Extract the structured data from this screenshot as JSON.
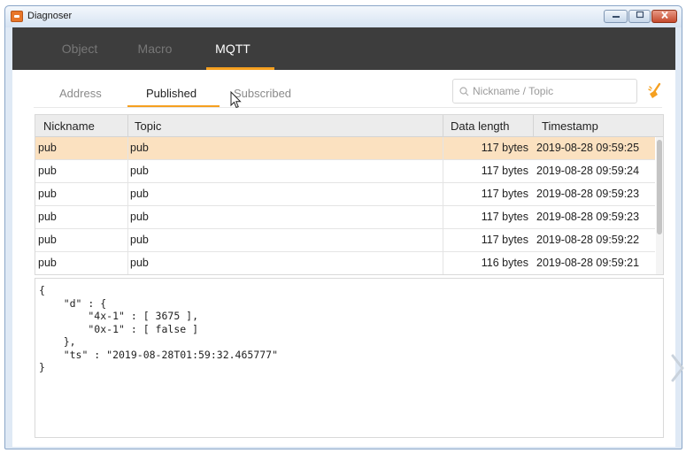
{
  "window": {
    "title": "Diagnoser"
  },
  "main_tabs": [
    {
      "label": "Object"
    },
    {
      "label": "Macro"
    },
    {
      "label": "MQTT"
    }
  ],
  "sub_tabs": [
    {
      "label": "Address"
    },
    {
      "label": "Published"
    },
    {
      "label": "Subscribed"
    }
  ],
  "search": {
    "placeholder": "Nickname / Topic",
    "value": ""
  },
  "table": {
    "columns": [
      "Nickname",
      "Topic",
      "Data length",
      "Timestamp"
    ],
    "rows": [
      {
        "nickname": "pub",
        "topic": "pub",
        "length": "117 bytes",
        "timestamp": "2019-08-28 09:59:25"
      },
      {
        "nickname": "pub",
        "topic": "pub",
        "length": "117 bytes",
        "timestamp": "2019-08-28 09:59:24"
      },
      {
        "nickname": "pub",
        "topic": "pub",
        "length": "117 bytes",
        "timestamp": "2019-08-28 09:59:23"
      },
      {
        "nickname": "pub",
        "topic": "pub",
        "length": "117 bytes",
        "timestamp": "2019-08-28 09:59:23"
      },
      {
        "nickname": "pub",
        "topic": "pub",
        "length": "117 bytes",
        "timestamp": "2019-08-28 09:59:22"
      },
      {
        "nickname": "pub",
        "topic": "pub",
        "length": "116 bytes",
        "timestamp": "2019-08-28 09:59:21"
      }
    ]
  },
  "detail": {
    "payload": "{\n    \"d\" : {\n        \"4x-1\" : [ 3675 ],\n        \"0x-1\" : [ false ]\n    },\n    \"ts\" : \"2019-08-28T01:59:32.465777\"\n}"
  },
  "colors": {
    "accent": "#f5a020",
    "selected_row": "#fbe1c0",
    "topbar": "#3d3d3d"
  }
}
